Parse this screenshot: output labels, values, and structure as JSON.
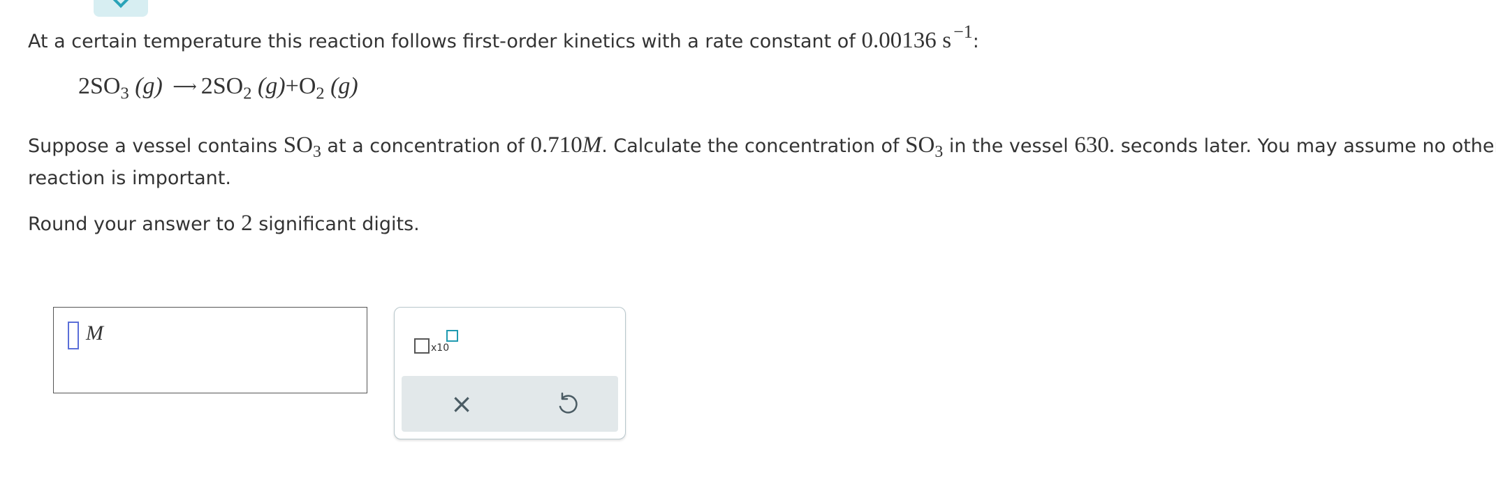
{
  "problem": {
    "line1_text": "At a certain temperature this reaction follows first-order kinetics with a rate constant of",
    "rate_constant": "0.00136",
    "rate_unit": "s",
    "rate_unit_exp": "−1",
    "line1_end": ":",
    "equation": {
      "coef1": "2",
      "r_species": "SO",
      "r_sub": "3",
      "state": "(g)",
      "coef2": "2",
      "p1_species": "SO",
      "p1_sub": "2",
      "plus": "+",
      "p2_species": "O",
      "p2_sub": "2"
    },
    "line2_a": "Suppose a vessel contains",
    "species": "SO",
    "species_sub": "3",
    "line2_b": "at a concentration of",
    "concentration": "0.710",
    "conc_unit": "M",
    "line2_c": ". Calculate the concentration of",
    "line2_d": "in the vessel",
    "time_value": "630.",
    "line2_e": "seconds later. You may assume no other",
    "line2_f": "reaction is important.",
    "round_a": "Round your answer to",
    "sig_digits": "2",
    "round_b": "significant digits."
  },
  "answer": {
    "unit": "M"
  },
  "tools": {
    "sci_label": "x10",
    "clear_symbol": "×"
  },
  "colors": {
    "accent": "#29a3b8",
    "input_cursor": "#5b6fd8",
    "toolbar_bg": "#e2e8ea"
  }
}
